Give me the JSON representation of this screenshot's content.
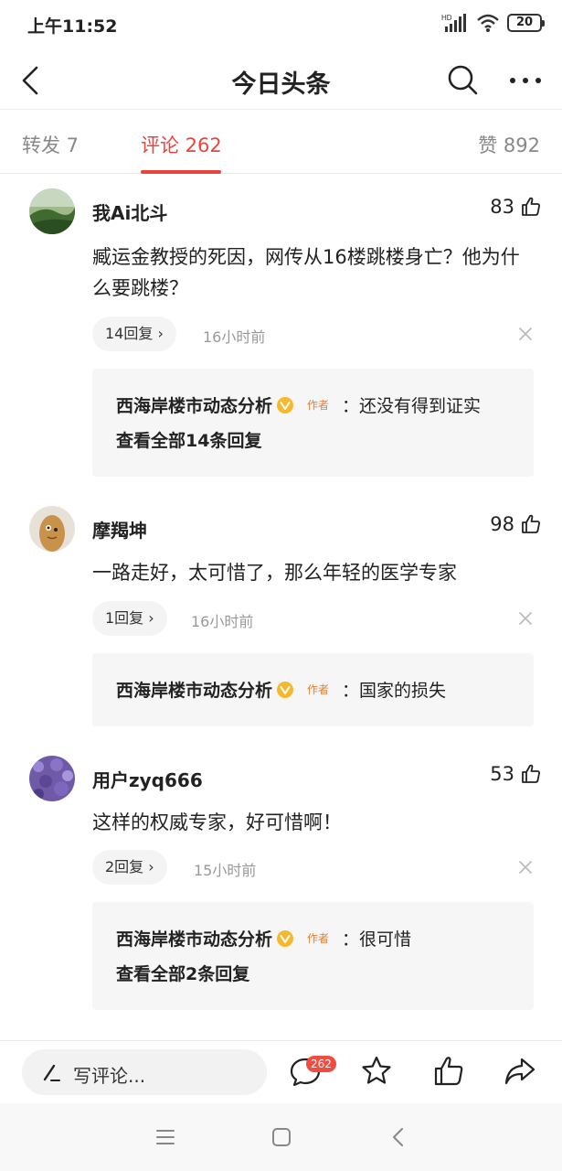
{
  "status_bar": {
    "time": "上午11:52",
    "battery": "20",
    "hd_label": "HD"
  },
  "header": {
    "title": "今日头条"
  },
  "tabs": {
    "repost": "转发 7",
    "comment": "评论 262",
    "like": "赞 892",
    "active_color": "#e8453c"
  },
  "comments": [
    {
      "username": "我Ai北斗",
      "likes": "83",
      "text": "臧运金教授的死因，网传从16楼跳楼身亡？他为什么要跳楼？",
      "reply_count": "14回复",
      "time": "16小时前",
      "reply": {
        "author": "西海岸楼市动态分析",
        "tag": "作者",
        "text": "：还没有得到证实",
        "view_all": "查看全部14条回复"
      }
    },
    {
      "username": "摩羯坤",
      "likes": "98",
      "text": "一路走好，太可惜了，那么年轻的医学专家",
      "reply_count": "1回复",
      "time": "16小时前",
      "reply": {
        "author": "西海岸楼市动态分析",
        "tag": "作者",
        "text": "：国家的损失"
      }
    },
    {
      "username": "用户zyq666",
      "likes": "53",
      "text": "这样的权威专家，好可惜啊！",
      "reply_count": "2回复",
      "time": "15小时前",
      "reply": {
        "author": "西海岸楼市动态分析",
        "tag": "作者",
        "text": "：很可惜",
        "view_all": "查看全部2条回复"
      }
    }
  ],
  "bottom_bar": {
    "write_placeholder": "写评论...",
    "comment_badge": "262"
  },
  "icons": [
    "back-arrow-icon",
    "search-icon",
    "more-icon",
    "thumb-up-icon",
    "close-icon",
    "verified-icon",
    "pen-icon",
    "comment-icon",
    "star-icon",
    "share-icon",
    "menu-icon",
    "home-icon",
    "back-icon"
  ]
}
